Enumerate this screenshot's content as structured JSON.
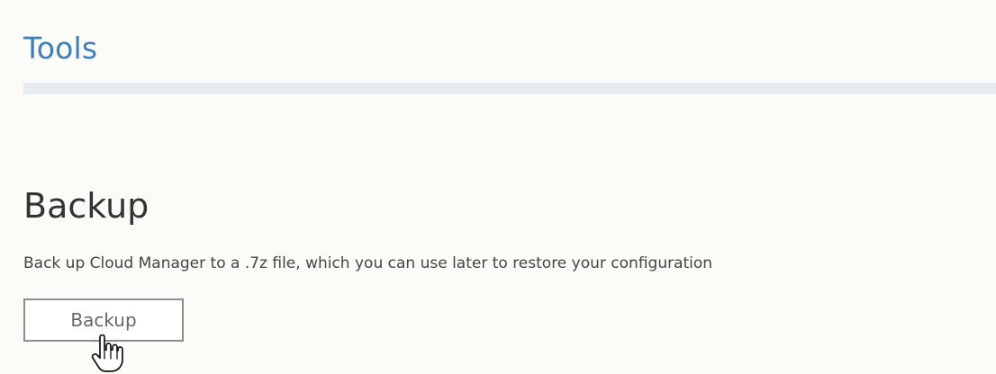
{
  "header": {
    "title": "Tools"
  },
  "backup_section": {
    "title": "Backup",
    "description": "Back up Cloud Manager to a .7z file, which you can use later to restore your configuration",
    "button_label": "Backup"
  },
  "cursor": {
    "icon": "hand-pointer-icon"
  }
}
